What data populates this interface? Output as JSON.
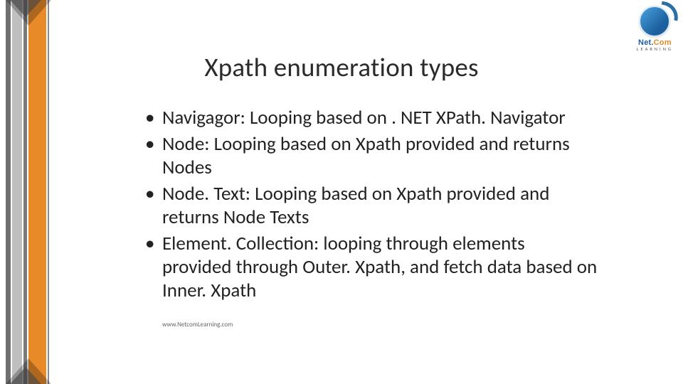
{
  "title": "Xpath enumeration types",
  "bullets": [
    "Navigagor: Looping based on . NET XPath. Navigator",
    "Node: Looping based on Xpath provided and returns Nodes",
    "Node. Text: Looping based on Xpath provided and returns Node Texts",
    "Element. Collection: looping through elements provided through Outer. Xpath, and fetch data based on Inner. Xpath"
  ],
  "footer_url": "www.NetcomLearning.com",
  "logo": {
    "brand_main": "Net.",
    "brand_accent": "Com",
    "subtitle": "LEARNING"
  }
}
